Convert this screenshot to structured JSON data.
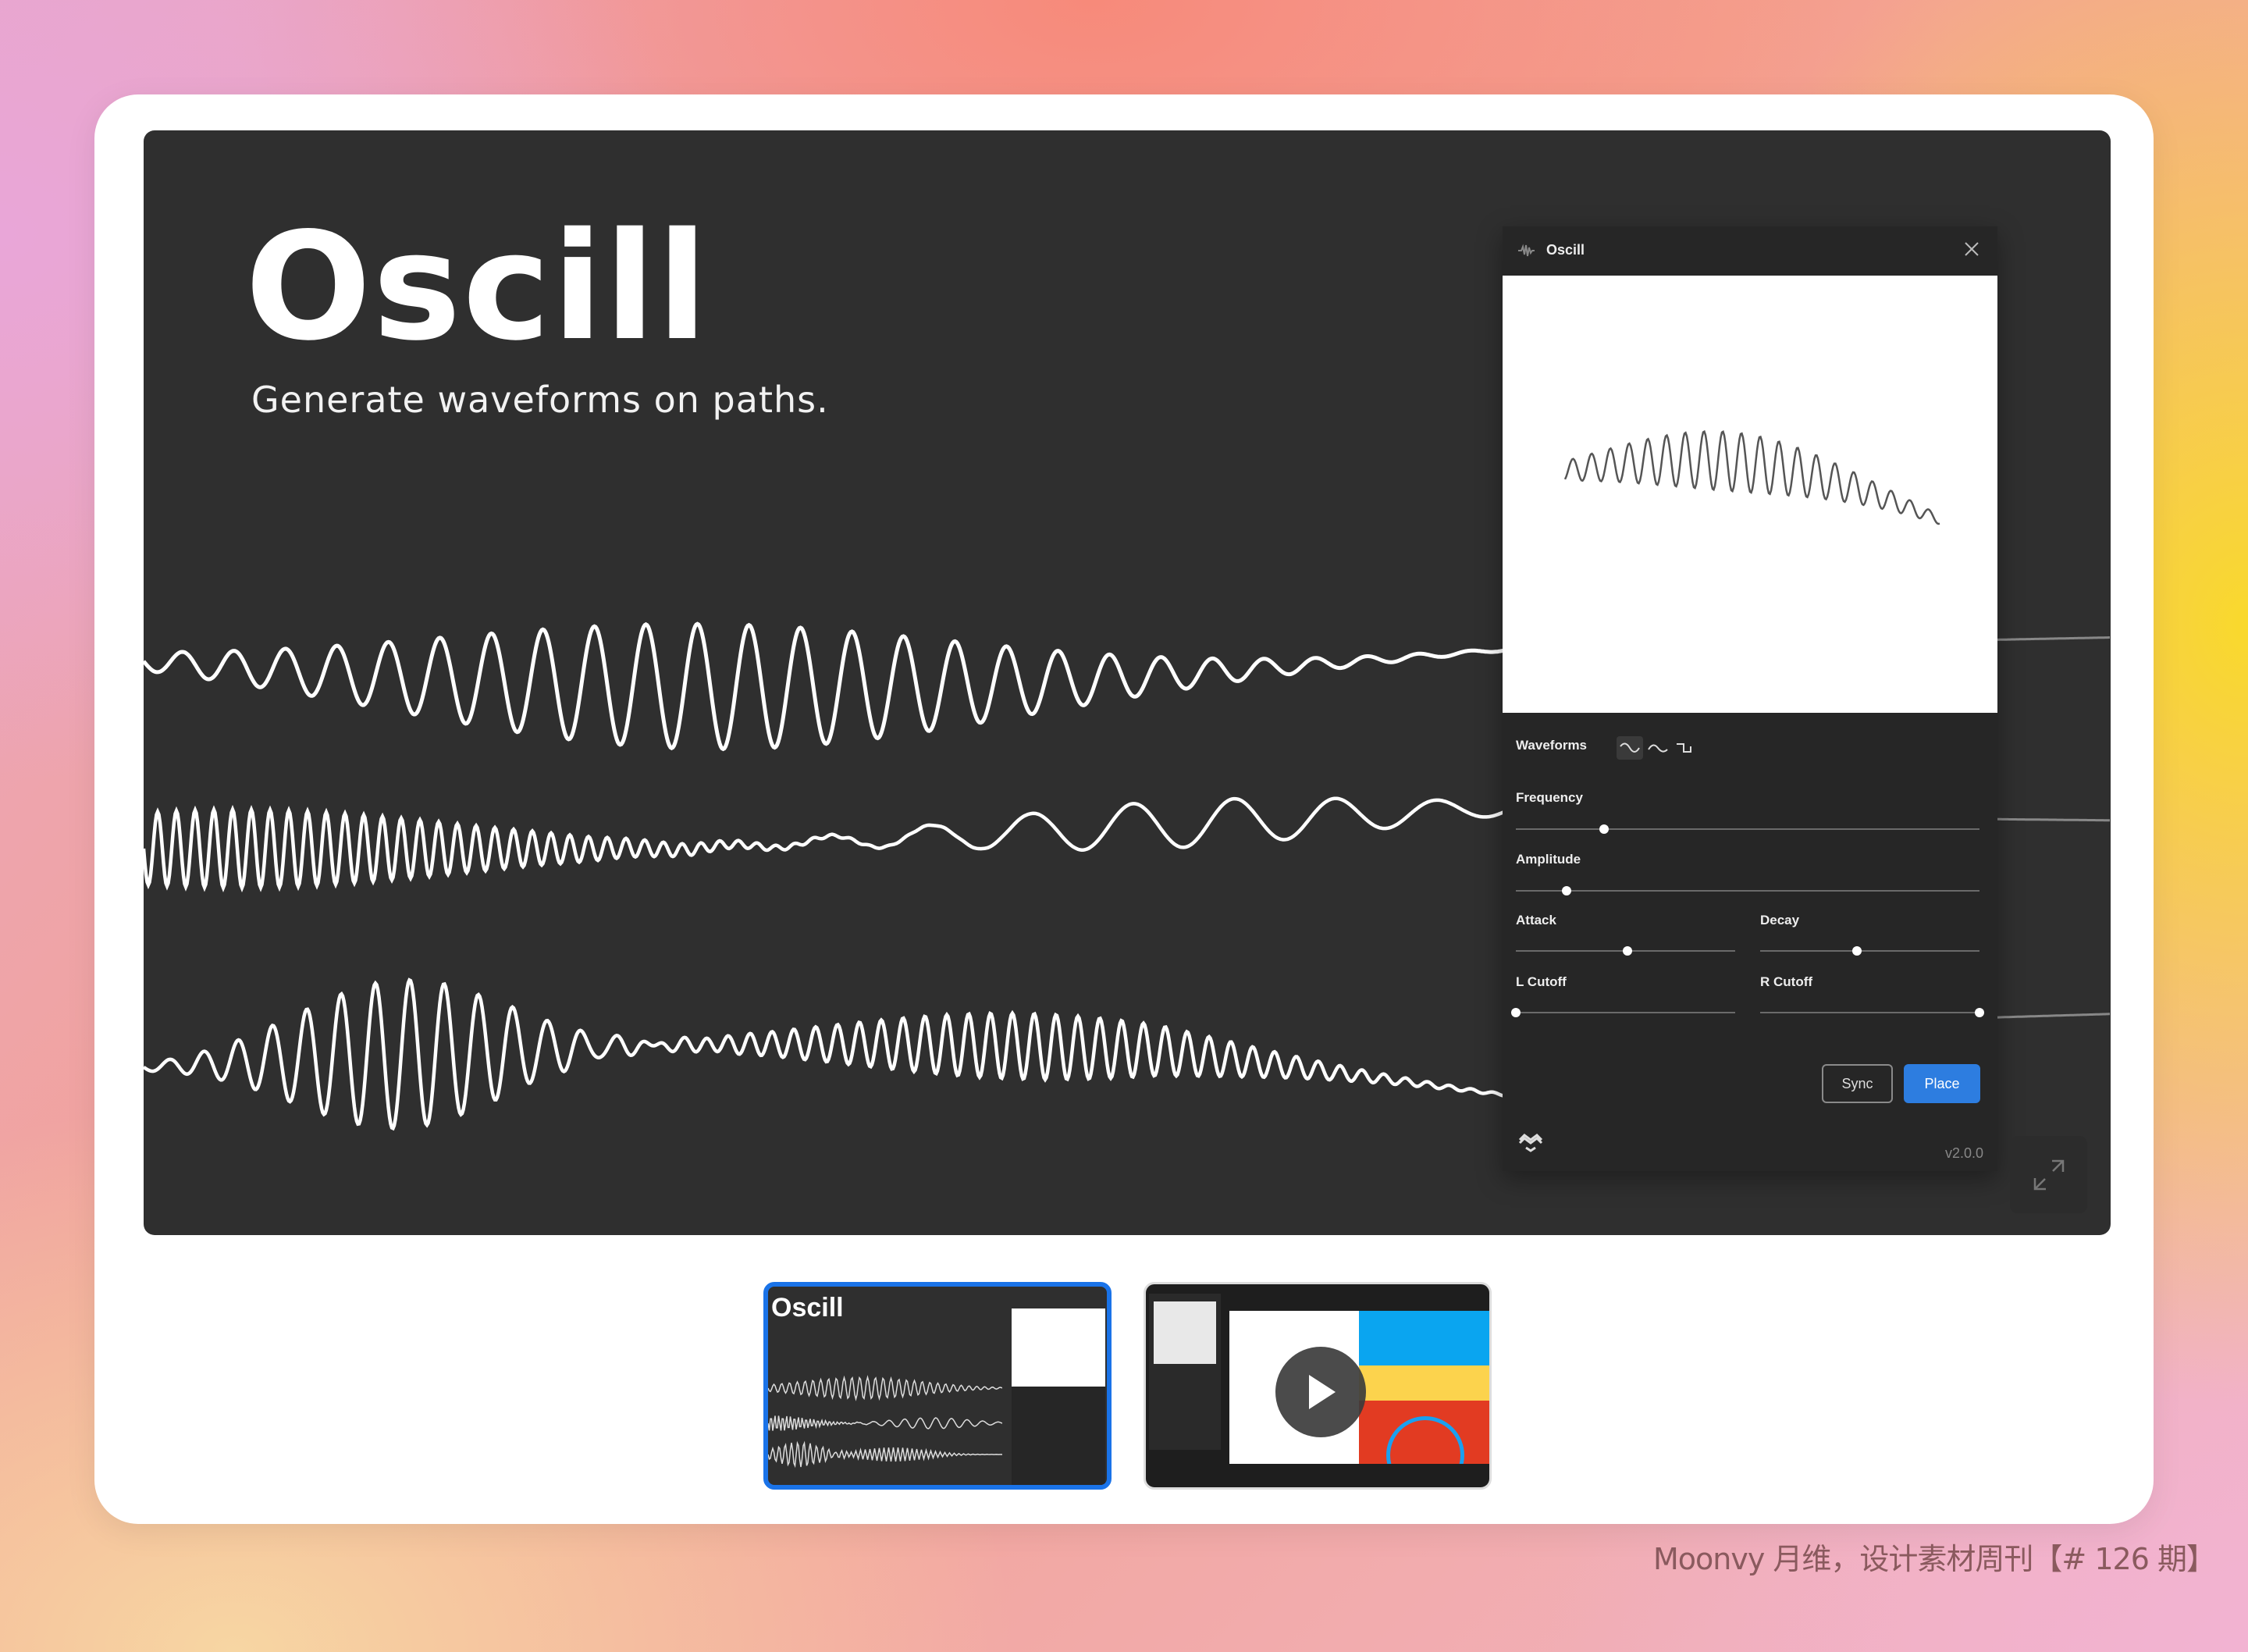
{
  "hero": {
    "title": "Oscill",
    "subtitle": "Generate waveforms on paths."
  },
  "plugin": {
    "title": "Oscill",
    "waveforms_label": "Waveforms",
    "waveform_options": [
      {
        "icon": "sine-wave-icon",
        "selected": true
      },
      {
        "icon": "smooth-wave-icon",
        "selected": false
      },
      {
        "icon": "square-wave-icon",
        "selected": false
      }
    ],
    "sliders": {
      "frequency": {
        "label": "Frequency",
        "value": 0.19
      },
      "amplitude": {
        "label": "Amplitude",
        "value": 0.11
      },
      "attack": {
        "label": "Attack",
        "value": 0.51
      },
      "decay": {
        "label": "Decay",
        "value": 0.44
      },
      "l_cutoff": {
        "label": "L Cutoff",
        "value": 0.0
      },
      "r_cutoff": {
        "label": "R Cutoff",
        "value": 1.0
      }
    },
    "sync_label": "Sync",
    "place_label": "Place",
    "version": "v2.0.0"
  },
  "thumbnails": [
    {
      "title": "Oscill",
      "selected": true,
      "type": "image"
    },
    {
      "type": "video",
      "selected": false
    }
  ],
  "colors": {
    "accent": "#2d7de0",
    "selected_border": "#1a73e8",
    "stage": "#2f2f2f"
  },
  "watermark": "Moonvy 月维，设计素材周刊【# 126 期】"
}
